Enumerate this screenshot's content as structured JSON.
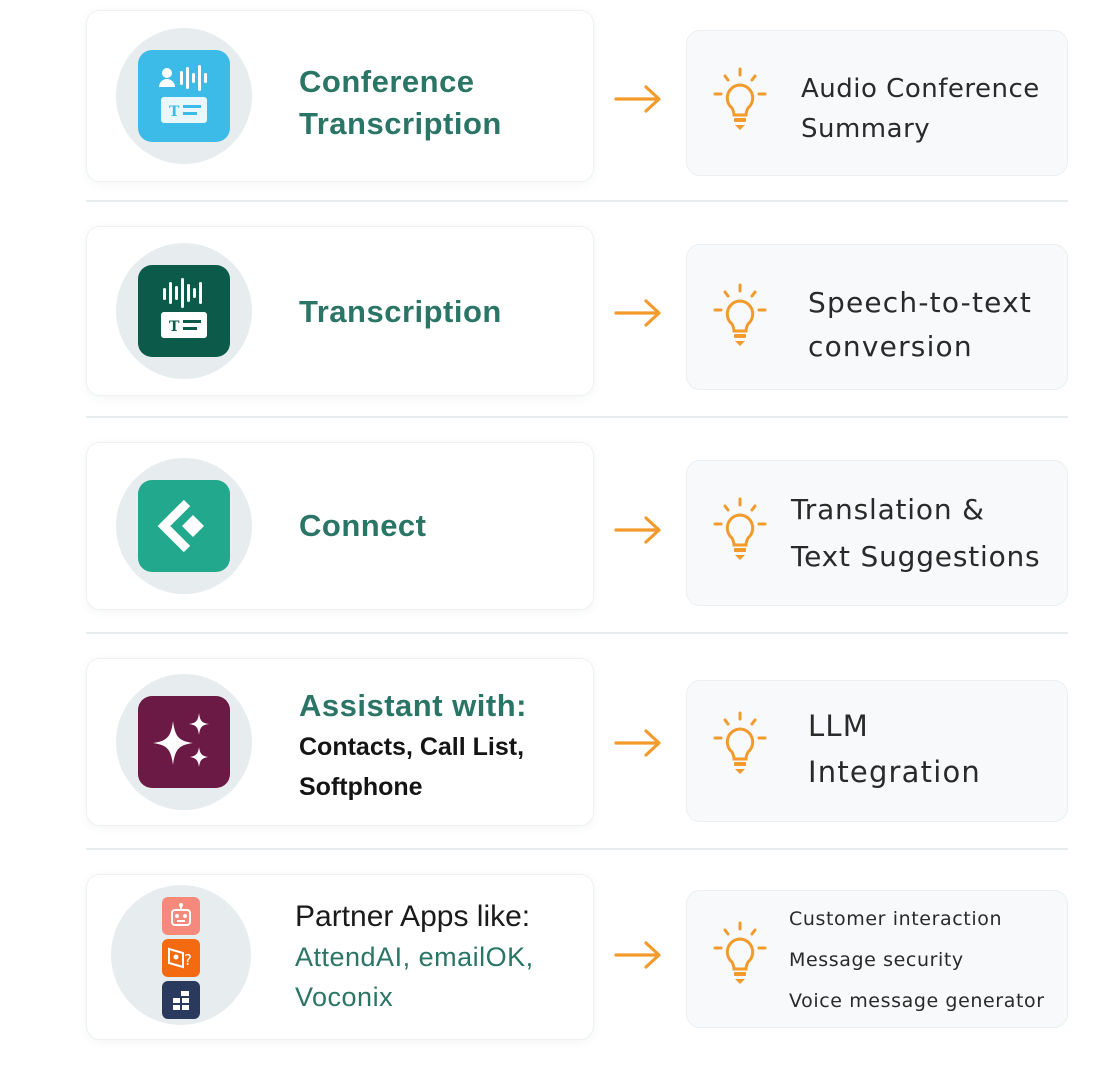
{
  "rows": [
    {
      "app_title_lines": [
        "Conference",
        "Transcription"
      ],
      "result_lines": [
        "Audio Conference",
        "Summary"
      ]
    },
    {
      "app_title_lines": [
        "Transcription"
      ],
      "result_lines": [
        "Speech-to-text",
        "conversion"
      ]
    },
    {
      "app_title_lines": [
        "Connect"
      ],
      "result_lines": [
        "Translation &",
        "Text Suggestions"
      ]
    },
    {
      "app_title": "Assistant with:",
      "app_subtitle_lines": [
        "Contacts, Call List,",
        "Softphone"
      ],
      "result_lines": [
        "LLM",
        "Integration"
      ]
    },
    {
      "app_title": "Partner Apps like:",
      "app_subtitle_lines": [
        "AttendAI, emailOK,",
        "Voconix"
      ],
      "result_lines": [
        "Customer interaction",
        "Message security",
        "Voice message generator"
      ]
    }
  ],
  "icons": {
    "row1": "conference-transcription-icon",
    "row2": "transcription-icon",
    "row3": "connect-icon",
    "row4": "assistant-sparkle-icon",
    "row5": [
      "attendai-robot-icon",
      "emailok-icon",
      "voconix-icon"
    ],
    "arrow": "arrow-right-icon",
    "result": "lightbulb-icon"
  },
  "colors": {
    "title_green": "#2a7566",
    "arrow_orange": "#f39a2c",
    "conference_blue": "#3dbbe8",
    "transcription_dark_green": "#0c5a4a",
    "connect_teal": "#22a98d",
    "assistant_plum": "#6b1a45"
  }
}
